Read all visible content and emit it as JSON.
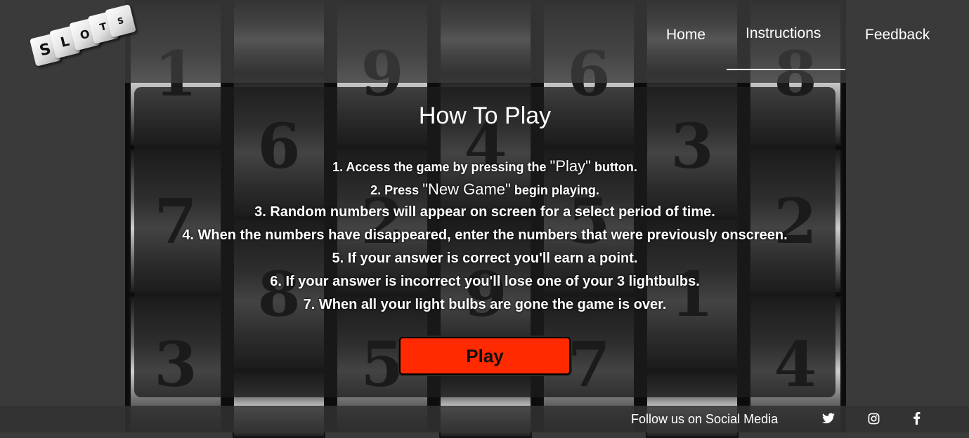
{
  "header": {
    "logo_letters": [
      "S",
      "L",
      "O",
      "T",
      "S"
    ],
    "nav": [
      {
        "label": "Home",
        "active": false
      },
      {
        "label": "Instructions",
        "active": true
      },
      {
        "label": "Feedback",
        "active": false
      }
    ]
  },
  "background_reels": [
    [
      "1",
      "7",
      "3"
    ],
    [
      "",
      "6",
      "8",
      ""
    ],
    [
      "9",
      "2",
      "5"
    ],
    [
      "",
      "4",
      "9",
      ""
    ],
    [
      "6",
      "5",
      "7"
    ],
    [
      "",
      "3",
      "1",
      ""
    ],
    [
      "8",
      "2",
      "4"
    ]
  ],
  "instructions": {
    "title": "How To Play",
    "steps": [
      {
        "before": "1. Access the game by pressing the ",
        "quoted": "\"Play\"",
        "after": " button."
      },
      {
        "before": "2. Press ",
        "quoted": "\"New Game\"",
        "after": " begin playing."
      },
      {
        "text": "3. Random numbers will appear on screen for a select period of time."
      },
      {
        "text": "4. When the numbers have disappeared, enter the numbers that were previously onscreen."
      },
      {
        "text": "5. If your answer is correct you'll earn a point."
      },
      {
        "text": "6. If your answer is incorrect you'll lose one of your 3 lightbulbs."
      },
      {
        "text": "7. When all your light bulbs are gone the game is over."
      }
    ],
    "play_label": "Play"
  },
  "footer": {
    "follow_text": "Follow us on Social Media",
    "social_icons": [
      "twitter-icon",
      "instagram-icon",
      "facebook-icon"
    ]
  },
  "colors": {
    "play_button": "#ff2a00",
    "background": "#3a3a3a",
    "text": "#ffffff"
  }
}
